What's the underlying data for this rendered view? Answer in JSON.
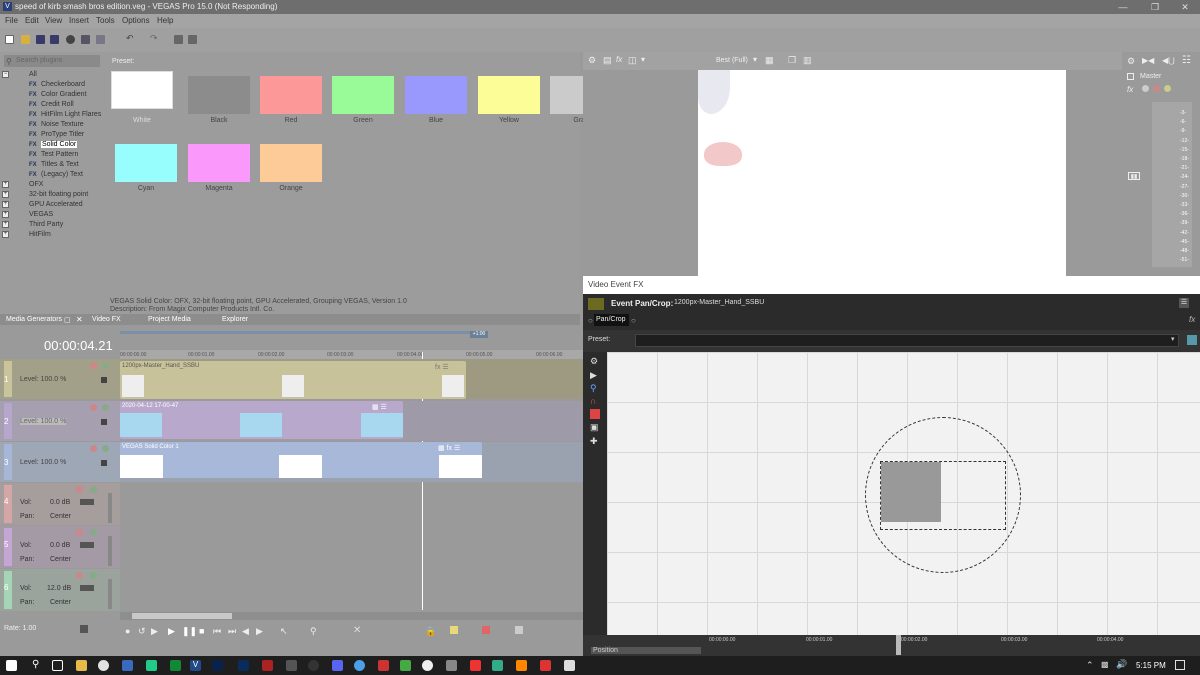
{
  "window": {
    "title": "speed of kirb smash bros edition.veg - VEGAS Pro 15.0 (Not Responding)",
    "app_icon": "V"
  },
  "menu": [
    "File",
    "Edit",
    "View",
    "Insert",
    "Tools",
    "Options",
    "Help"
  ],
  "plugins": {
    "search_placeholder": "Search plugins",
    "tree": [
      {
        "label": "All",
        "type": "folder"
      },
      {
        "label": "Checkerboard",
        "type": "fx"
      },
      {
        "label": "Color Gradient",
        "type": "fx"
      },
      {
        "label": "Credit Roll",
        "type": "fx"
      },
      {
        "label": "HitFilm Light Flares",
        "type": "fx"
      },
      {
        "label": "Noise Texture",
        "type": "fx"
      },
      {
        "label": "ProType Titler",
        "type": "fx"
      },
      {
        "label": "Solid Color",
        "type": "fx",
        "selected": true
      },
      {
        "label": "Test Pattern",
        "type": "fx"
      },
      {
        "label": "Titles & Text",
        "type": "fx"
      },
      {
        "label": "(Legacy) Text",
        "type": "fx"
      },
      {
        "label": "OFX",
        "type": "group"
      },
      {
        "label": "32-bit floating point",
        "type": "group"
      },
      {
        "label": "GPU Accelerated",
        "type": "group"
      },
      {
        "label": "VEGAS",
        "type": "group"
      },
      {
        "label": "Third Party",
        "type": "group"
      },
      {
        "label": "HitFilm",
        "type": "group"
      }
    ],
    "preset_label": "Preset:",
    "swatches": [
      {
        "name": "White",
        "color": "#ffffff"
      },
      {
        "name": "Black",
        "color": "#8c8c8c"
      },
      {
        "name": "Red",
        "color": "#fd9898"
      },
      {
        "name": "Green",
        "color": "#98fb98"
      },
      {
        "name": "Blue",
        "color": "#9898fd"
      },
      {
        "name": "Yellow",
        "color": "#fdfd98"
      },
      {
        "name": "Gray",
        "color": "#cbcbcb"
      },
      {
        "name": "Cyan",
        "color": "#98fdfd"
      },
      {
        "name": "Magenta",
        "color": "#fb98fb"
      },
      {
        "name": "Orange",
        "color": "#fdcb98"
      }
    ],
    "description_line1": "VEGAS Solid Color: OFX, 32-bit floating point, GPU Accelerated, Grouping VEGAS, Version 1.0",
    "description_line2": "Description: From Magix Computer Products Intl. Co."
  },
  "tabs": {
    "media_generators": "Media Generators",
    "video_fx": "Video FX",
    "project_media": "Project Media",
    "explorer": "Explorer"
  },
  "timeline": {
    "timecode": "00:00:04.21",
    "rate": "Rate: 1.00",
    "end_marker": "+1:00",
    "ruler": [
      "00:00:00.00",
      "00:00:01.00",
      "00:00:02.00",
      "00:00:03.00",
      "00:00:04.00",
      "00:00:05.00",
      "00:00:06.00"
    ],
    "video_tracks": [
      {
        "num": "1",
        "level_label": "Level: 100.0 %",
        "clip_name": "1200px-Master_Hand_SSBU",
        "color": "#c8c29a"
      },
      {
        "num": "2",
        "level_label": "Level: 100.0 %",
        "clip_name": "2020-04-12 17-00-47",
        "color": "#b8a8cc"
      },
      {
        "num": "3",
        "level_label": "Level: 100.0 %",
        "clip_name": "VEGAS Solid Color 1",
        "color": "#a8b8d8"
      }
    ],
    "audio_tracks": [
      {
        "num": "4",
        "vol_label": "Vol:",
        "vol": "0.0 dB",
        "pan_label": "Pan:",
        "pan": "Center"
      },
      {
        "num": "5",
        "vol_label": "Vol:",
        "vol": "0.0 dB",
        "pan_label": "Pan:",
        "pan": "Center"
      },
      {
        "num": "6",
        "vol_label": "Vol:",
        "vol": "12.0 dB",
        "pan_label": "Pan:",
        "pan": "Center"
      }
    ]
  },
  "preview": {
    "quality": "Best (Full)"
  },
  "master": {
    "label": "Master",
    "meter_ticks": [
      "3",
      "6",
      "9",
      "12",
      "15",
      "18",
      "21",
      "24",
      "27",
      "30",
      "33",
      "36",
      "39",
      "42",
      "45",
      "48",
      "51"
    ]
  },
  "vef": {
    "title": "Video Event FX",
    "chain_label": "Event Pan/Crop:",
    "chain_target": "1200px-Master_Hand_SSBU",
    "tab": "Pan/Crop",
    "preset_label": "Preset:",
    "position_label": "Position",
    "ruler": [
      "00:00:00.00",
      "00:00:01.00",
      "00:00:02.00",
      "00:00:03.00",
      "00:00:04.00"
    ]
  },
  "taskbar": {
    "time": "5:15 PM"
  }
}
